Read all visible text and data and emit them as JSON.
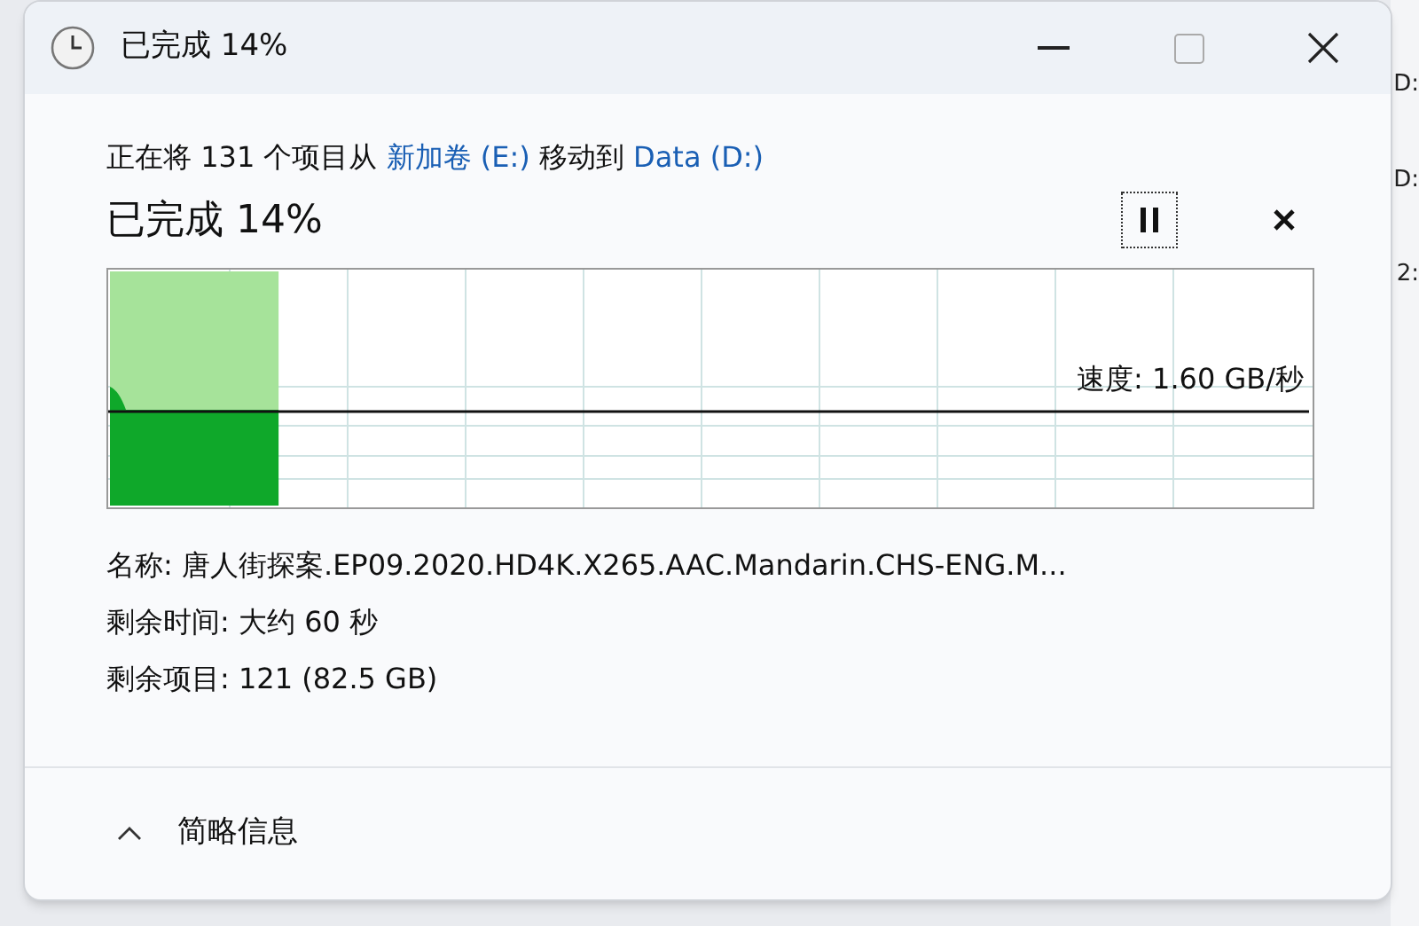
{
  "window": {
    "title": "已完成 14%"
  },
  "message": [
    {
      "kind": "plain",
      "text": "正在将 131 个项目从 "
    },
    {
      "kind": "link",
      "text": "新加卷 (E:)"
    },
    {
      "kind": "plain",
      "text": " 移动到 "
    },
    {
      "kind": "link",
      "text": "Data (D:)"
    }
  ],
  "progress": {
    "title": "已完成 14%",
    "level": 0.14,
    "speed": "速度: 1.60 GB/秒"
  },
  "details": [
    "名称: 唐人街探案.EP09.2020.HD4K.X265.AAC.Mandarin.CHS-ENG.M...",
    "剩余时间: 大约 60 秒",
    "剩余项目: 121 (82.5 GB)"
  ],
  "footer": {
    "toggle": "简略信息"
  },
  "background_texts": [
    "D:",
    "D:",
    "2:"
  ]
}
